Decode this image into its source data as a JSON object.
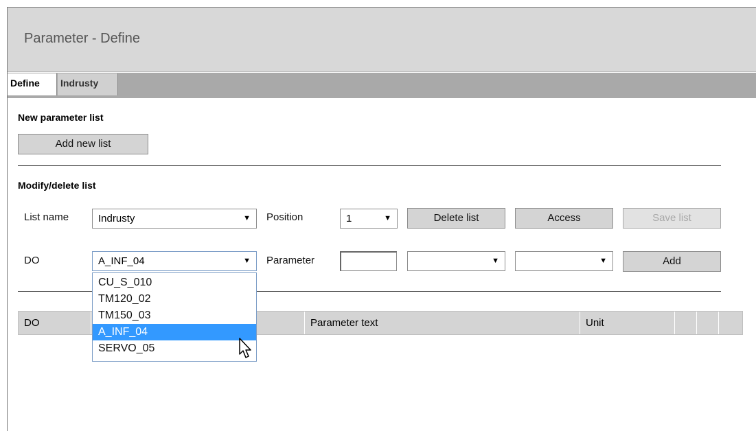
{
  "header": {
    "title": "Parameter - Define"
  },
  "tabs": [
    {
      "label": "Define",
      "active": true
    },
    {
      "label": "Indrusty",
      "active": false
    }
  ],
  "new_list": {
    "title": "New parameter list",
    "add_button": "Add new list"
  },
  "modify_list": {
    "title": "Modify/delete list",
    "list_name_label": "List name",
    "list_name_value": "Indrusty",
    "position_label": "Position",
    "position_value": "1",
    "delete_button": "Delete list",
    "access_button": "Access",
    "save_button": "Save list",
    "do_label": "DO",
    "do_value": "A_INF_04",
    "parameter_label": "Parameter",
    "parameter_value": "",
    "parameter_select_1": "",
    "parameter_select_2": "",
    "add_button": "Add"
  },
  "do_dropdown": {
    "options": [
      "CU_S_010",
      "TM120_02",
      "TM150_03",
      "A_INF_04",
      "SERVO_05"
    ],
    "selected": "A_INF_04"
  },
  "table": {
    "columns": [
      "DO",
      "",
      "Parameter text",
      "Unit",
      "",
      "",
      ""
    ]
  },
  "colors": {
    "header_bg": "#d8d8d8",
    "tabbar_bg": "#a9a9a9",
    "selection": "#3399ff"
  }
}
